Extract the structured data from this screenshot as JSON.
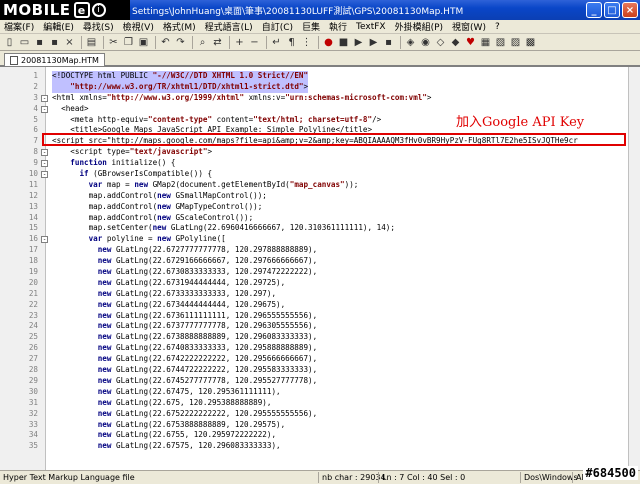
{
  "window": {
    "logo_text": "MOBILE",
    "logo_badge": "e",
    "logo_badge2": "i",
    "title": "Settings\\JohnHuang\\桌面\\筆事\\20081130LUFF測試\\GPS\\20081130Map.HTM",
    "buttons": [
      "_",
      "□",
      "×"
    ]
  },
  "menu": [
    "檔案(F)",
    "編輯(E)",
    "尋找(S)",
    "檢視(V)",
    "格式(M)",
    "程式語言(L)",
    "自訂(C)",
    "巨集",
    "執行",
    "TextFX",
    "外掛模組(P)",
    "視窗(W)",
    "?"
  ],
  "tab": {
    "label": "20081130Map.HTM"
  },
  "annotation": "加入Google API Key",
  "code_lines": [
    {
      "n": "1",
      "t": "<!DOCTYPE html PUBLIC \"-//W3C//DTD XHTML 1.0 Strict//EN\"",
      "sel": true
    },
    {
      "n": "2",
      "t": "    \"http://www.w3.org/TR/xhtml1/DTD/xhtml1-strict.dtd\">",
      "sel": true
    },
    {
      "n": "3",
      "t": "<html xmlns=\"http://www.w3.org/1999/xhtml\" xmlns:v=\"urn:schemas-microsoft-com:vml\">",
      "fold": "-"
    },
    {
      "n": "4",
      "t": "  <head>",
      "fold": "-"
    },
    {
      "n": "5",
      "t": "    <meta http-equiv=\"content-type\" content=\"text/html; charset=utf-8\"/>"
    },
    {
      "n": "6",
      "t": "    <title>Google Maps JavaScript API Example: Simple Polyline</title>"
    },
    {
      "n": "7",
      "t": "<script src=\"http://maps.google.com/maps?file=api&amp;v=2&amp;key=ABQIAAAAQM3fHv0vBR9HyPzV-FUg8RTl7E2he5ISvJQTHe9cr"
    },
    {
      "n": "8",
      "t": "    <script type=\"text/javascript\">",
      "fold": "-"
    },
    {
      "n": "9",
      "t": "    function initialize() {",
      "fold": "-"
    },
    {
      "n": "10",
      "t": "      if (GBrowserIsCompatible()) {",
      "fold": "-"
    },
    {
      "n": "11",
      "t": "        var map = new GMap2(document.getElementById(\"map_canvas\"));"
    },
    {
      "n": "12",
      "t": "        map.addControl(new GSmallMapControl());"
    },
    {
      "n": "13",
      "t": "        map.addControl(new GMapTypeControl());"
    },
    {
      "n": "14",
      "t": "        map.addControl(new GScaleControl());"
    },
    {
      "n": "15",
      "t": "        map.setCenter(new GLatLng(22.6960416666667, 120.310361111111), 14);"
    },
    {
      "n": "16",
      "t": "        var polyline = new GPolyline([",
      "fold": "-"
    },
    {
      "n": "17",
      "t": "          new GLatLng(22.6727777777778, 120.297888888889),"
    },
    {
      "n": "18",
      "t": "          new GLatLng(22.6729166666667, 120.297666666667),"
    },
    {
      "n": "19",
      "t": "          new GLatLng(22.6730833333333, 120.297472222222),"
    },
    {
      "n": "20",
      "t": "          new GLatLng(22.6731944444444, 120.29725),"
    },
    {
      "n": "21",
      "t": "          new GLatLng(22.6733333333333, 120.297),"
    },
    {
      "n": "22",
      "t": "          new GLatLng(22.6734444444444, 120.29675),"
    },
    {
      "n": "23",
      "t": "          new GLatLng(22.6736111111111, 120.296555555556),"
    },
    {
      "n": "24",
      "t": "          new GLatLng(22.6737777777778, 120.296305555556),"
    },
    {
      "n": "25",
      "t": "          new GLatLng(22.6738888888889, 120.296083333333),"
    },
    {
      "n": "26",
      "t": "          new GLatLng(22.6740833333333, 120.295888888889),"
    },
    {
      "n": "27",
      "t": "          new GLatLng(22.6742222222222, 120.295666666667),"
    },
    {
      "n": "28",
      "t": "          new GLatLng(22.6744722222222, 120.295583333333),"
    },
    {
      "n": "29",
      "t": "          new GLatLng(22.6745277777778, 120.295527777778),"
    },
    {
      "n": "30",
      "t": "          new GLatLng(22.67475, 120.295361111111),"
    },
    {
      "n": "31",
      "t": "          new GLatLng(22.675, 120.295388888889),"
    },
    {
      "n": "32",
      "t": "          new GLatLng(22.6752222222222, 120.295555555556),"
    },
    {
      "n": "33",
      "t": "          new GLatLng(22.6753888888889, 120.29575),"
    },
    {
      "n": "34",
      "t": "          new GLatLng(22.6755, 120.295972222222),"
    },
    {
      "n": "35",
      "t": "          new GLatLng(22.67575, 120.296083333333),"
    }
  ],
  "status": {
    "file_type": "Hyper Text Markup Language file",
    "nb_char": "nb char : 29034",
    "position": "Ln : 7   Col : 40   Sel : 0",
    "eol": "Dos\\Windows",
    "encoding": "ANSI",
    "watermark": "#684500"
  },
  "colors": {
    "highlight": "#e00000",
    "selection": "#c0c0ff",
    "titlebar": "#0a46c8"
  }
}
